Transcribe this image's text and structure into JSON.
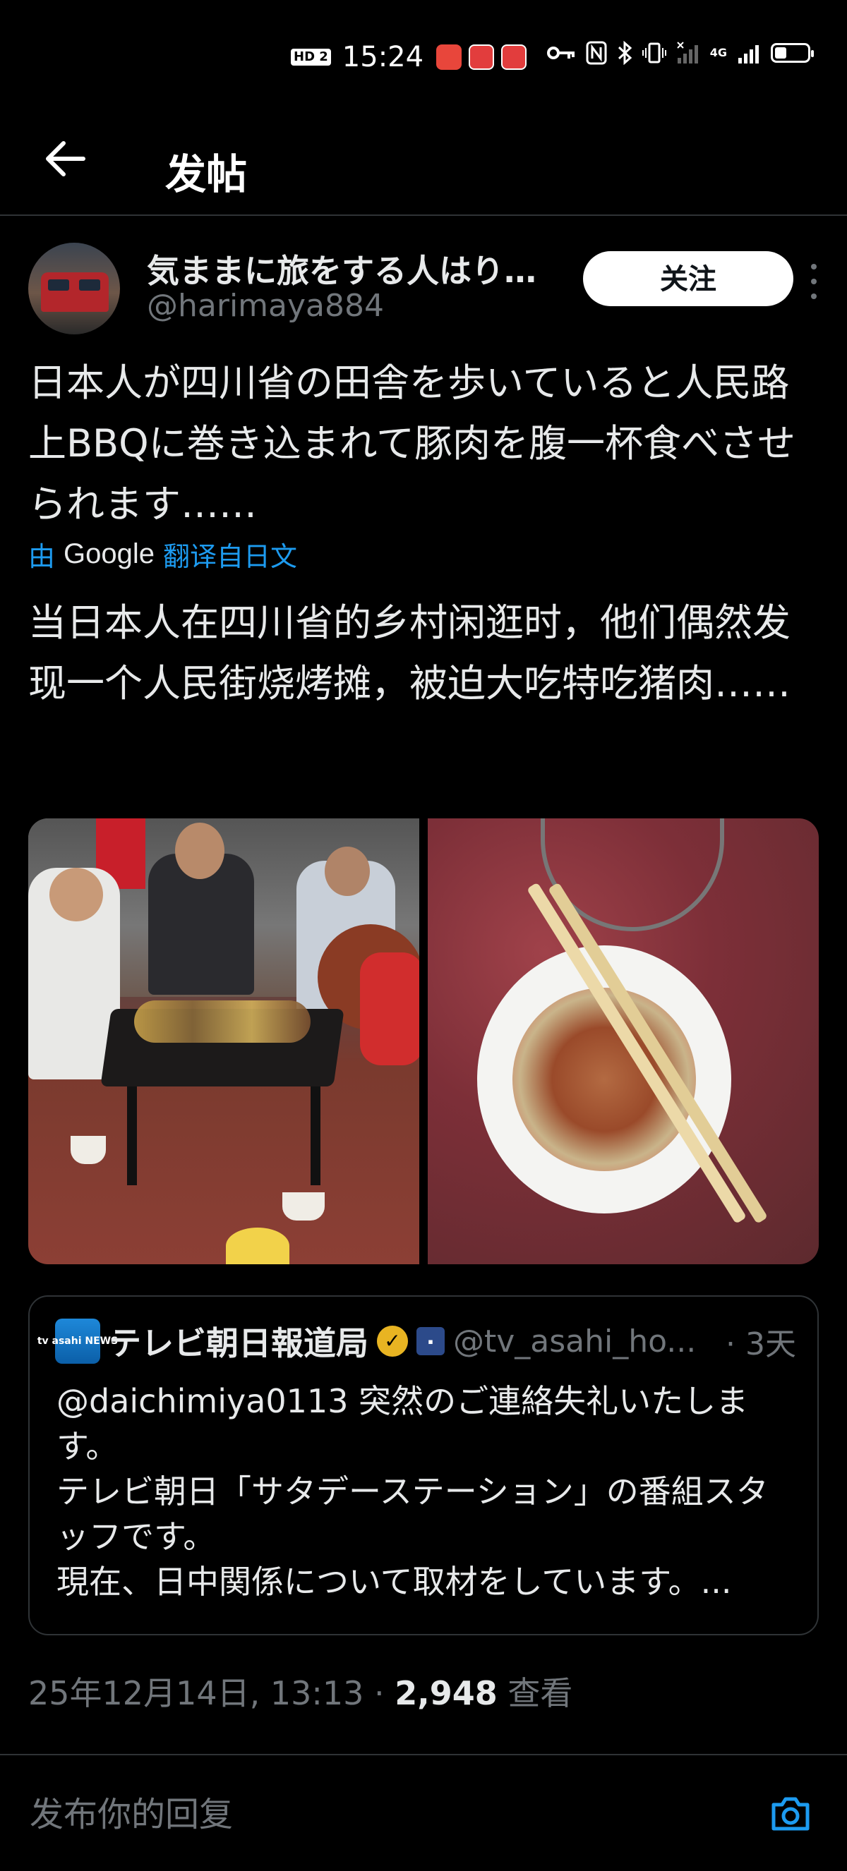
{
  "status_bar": {
    "hd_badge": "HD 2",
    "time": "15:24",
    "network": "4G",
    "app_icon_colors": [
      "#e8463b",
      "#e23d3d",
      "#e23d3d"
    ]
  },
  "header": {
    "title": "发帖",
    "back_icon": "arrow-left-icon"
  },
  "post": {
    "author": {
      "display_name": "気ままに旅をする人はり…",
      "handle": "@harimaya884"
    },
    "follow_label": "关注",
    "text_original": "日本人が四川省の田舎を歩いていると人民路上BBQに巻き込まれて豚肉を腹一杯食べさせられます……",
    "translation": {
      "prefix": "由",
      "provider": "Google",
      "suffix": "翻译自日文"
    },
    "text_translated": "当日本人在四川省的乡村闲逛时，他们偶然发现一个人民街烧烤摊，被迫大吃特吃猪肉……",
    "media": [
      {
        "description": "people-grilling-street-bbq"
      },
      {
        "description": "bowl-of-pork-with-chopsticks"
      }
    ],
    "quote": {
      "logo_text": "tv asahi NEWS",
      "name": "テレビ朝日報道局",
      "handle": "@tv_asahi_ho...",
      "time": "· 3天",
      "body": "@daichimiya0113 突然のご連絡失礼いたします。\nテレビ朝日「サタデーステーション」の番組スタッフです。\n現在、日中関係について取材をしています。..."
    },
    "timestamp": "25年12月14日, 13:13 · ",
    "views_count": "2,948",
    "views_label": "查看"
  },
  "reply": {
    "placeholder": "发布你的回复"
  },
  "colors": {
    "background": "#000000",
    "text": "#e7e9ea",
    "secondary": "#71767b",
    "accent": "#1d9bf0",
    "divider": "#2f3336"
  }
}
